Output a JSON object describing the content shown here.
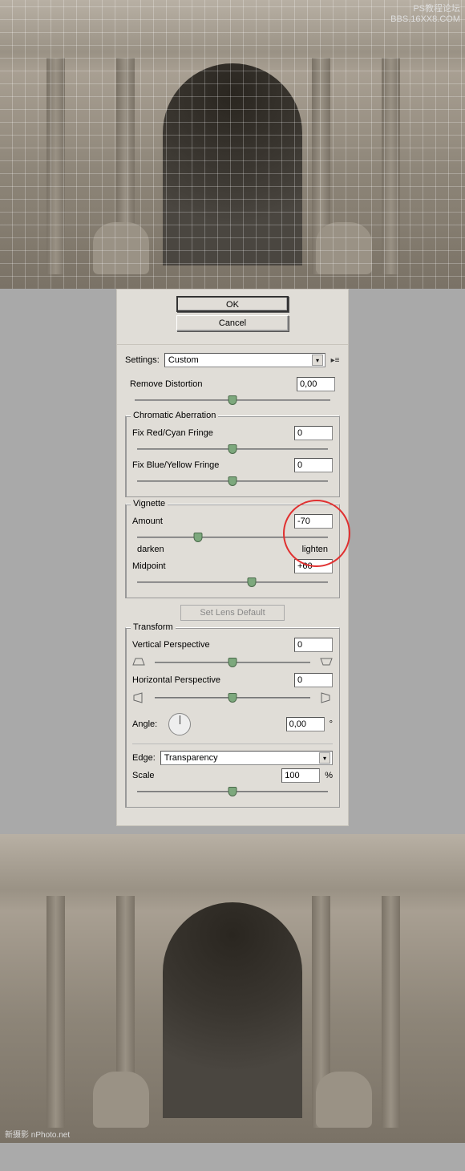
{
  "watermark_top": {
    "line1": "PS教程论坛",
    "line2": "BBS.16XX8.COM"
  },
  "watermark_bottom": "新摄影 nPhoto.net",
  "buttons": {
    "ok": "OK",
    "cancel": "Cancel"
  },
  "settings": {
    "label": "Settings:",
    "value": "Custom",
    "remove_distortion": {
      "label": "Remove Distortion",
      "value": "0,00",
      "pos": 50
    }
  },
  "chromatic": {
    "title": "Chromatic Aberration",
    "red": {
      "label": "Fix Red/Cyan Fringe",
      "value": "0",
      "pos": 50
    },
    "blue": {
      "label": "Fix Blue/Yellow Fringe",
      "value": "0",
      "pos": 50
    }
  },
  "vignette": {
    "title": "Vignette",
    "amount": {
      "label": "Amount",
      "value": "-70",
      "pos": 32,
      "left": "darken",
      "right": "lighten"
    },
    "midpoint": {
      "label": "Midpoint",
      "value": "+60",
      "pos": 60
    }
  },
  "set_lens": "Set Lens Default",
  "transform": {
    "title": "Transform",
    "vertical": {
      "label": "Vertical Perspective",
      "value": "0",
      "pos": 50
    },
    "horizontal": {
      "label": "Horizontal Perspective",
      "value": "0",
      "pos": 50
    },
    "angle": {
      "label": "Angle:",
      "value": "0,00",
      "unit": "°"
    },
    "edge": {
      "label": "Edge:",
      "value": "Transparency"
    },
    "scale": {
      "label": "Scale",
      "value": "100",
      "unit": "%",
      "pos": 50
    }
  }
}
